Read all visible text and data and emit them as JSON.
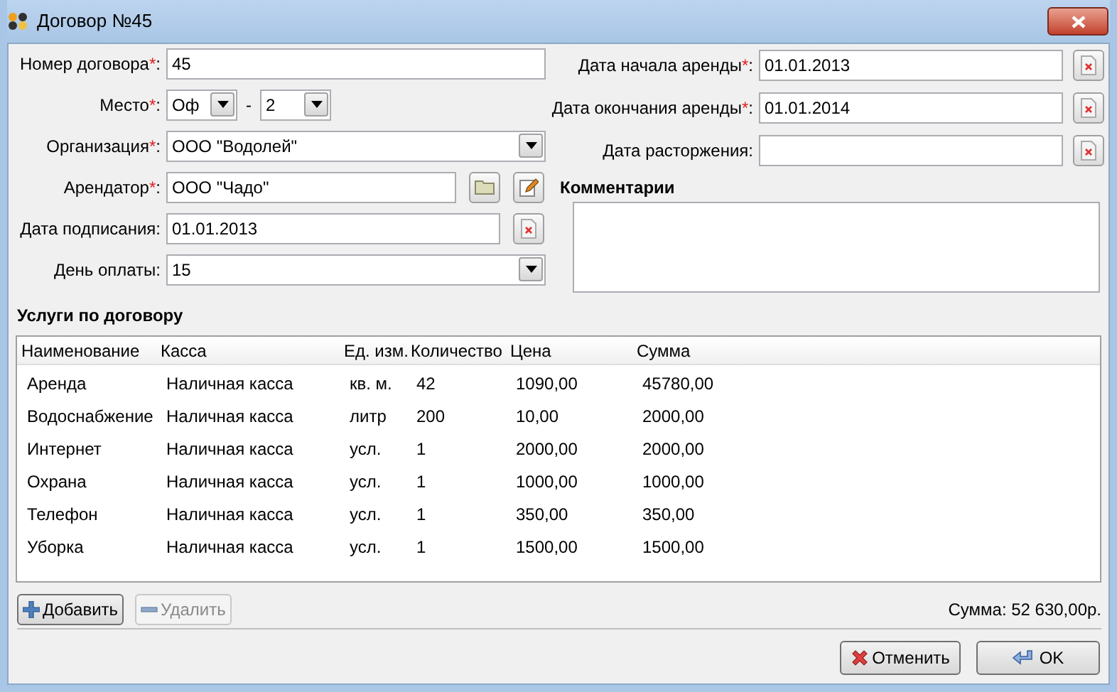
{
  "window": {
    "title": "Договор №45"
  },
  "left_fields": [
    {
      "kind": "text",
      "label": "Номер договора",
      "mark": "*",
      "colon": ":",
      "value": "45"
    },
    {
      "kind": "place",
      "label": "Место",
      "mark": "*",
      "colon": ":",
      "value": "Оф",
      "separator": "-",
      "value_2": "2"
    },
    {
      "kind": "combo",
      "label": "Организация",
      "mark": "*",
      "colon": ":",
      "value": "ООО \"Водолей\""
    },
    {
      "kind": "lookup",
      "label": "Арендатор",
      "mark": "*",
      "colon": ":",
      "value": "ООО \"Чадо\""
    },
    {
      "kind": "date",
      "label": "Дата подписания",
      "colon": ":",
      "value": "01.01.2013"
    },
    {
      "kind": "combo",
      "label": "День оплаты",
      "colon": ":",
      "value": "15"
    }
  ],
  "right_fields": [
    {
      "label": "Дата начала аренды",
      "mark": "*",
      "colon": ":",
      "value": "01.01.2013"
    },
    {
      "label": "Дата окончания аренды",
      "mark": "*",
      "colon": ":",
      "value": "01.01.2014"
    },
    {
      "label": "Дата расторжения",
      "colon": ":"
    }
  ],
  "comments": {
    "title": "Комментарии"
  },
  "services": {
    "title": "Услуги по договору",
    "columns": [
      "Наименование",
      "Касса",
      "Ед. изм.",
      "Количество",
      "Цена",
      "Сумма"
    ],
    "rows": [
      [
        "Аренда",
        "Наличная касса",
        "кв. м.",
        "42",
        "1090,00",
        "45780,00"
      ],
      [
        "Водоснабжение",
        "Наличная касса",
        "литр",
        "200",
        "10,00",
        "2000,00"
      ],
      [
        "Интернет",
        "Наличная касса",
        "усл.",
        "1",
        "2000,00",
        "2000,00"
      ],
      [
        "Охрана",
        "Наличная касса",
        "усл.",
        "1",
        "1000,00",
        "1000,00"
      ],
      [
        "Телефон",
        "Наличная касса",
        "усл.",
        "1",
        "350,00",
        "350,00"
      ],
      [
        "Уборка",
        "Наличная касса",
        "усл.",
        "1",
        "1500,00",
        "1500,00"
      ]
    ],
    "buttons": [
      {
        "label": "Добавить",
        "kind": "add",
        "disabled": false
      },
      {
        "label": "Удалить",
        "kind": "remove",
        "disabled": true
      }
    ],
    "total": "Сумма: 52 630,00р."
  },
  "footer_buttons": [
    {
      "label": "Отменить",
      "kind": "cancel"
    },
    {
      "label": "OK",
      "kind": "ok"
    }
  ]
}
